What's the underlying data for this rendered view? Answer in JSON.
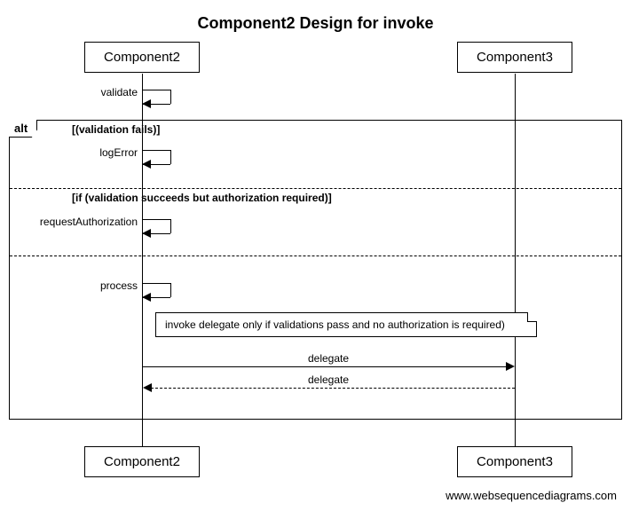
{
  "title": "Component2 Design for invoke",
  "participants": {
    "p1": "Component2",
    "p2": "Component3"
  },
  "messages": {
    "validate": "validate",
    "logError": "logError",
    "requestAuthorization": "requestAuthorization",
    "process": "process",
    "delegate_call": "delegate",
    "delegate_return": "delegate"
  },
  "alt": {
    "label": "alt",
    "guard1": "[(validation fails)]",
    "guard2": "[if (validation succeeds but authorization required)]"
  },
  "note": "invoke delegate only if validations pass and no authorization is required)",
  "footer": "www.websequencediagrams.com",
  "chart_data": {
    "type": "sequence-diagram",
    "title": "Component2 Design for invoke",
    "participants": [
      "Component2",
      "Component3"
    ],
    "interactions": [
      {
        "from": "Component2",
        "to": "Component2",
        "label": "validate",
        "kind": "self"
      },
      {
        "fragment": "alt",
        "sections": [
          {
            "guard": "(validation fails)",
            "interactions": [
              {
                "from": "Component2",
                "to": "Component2",
                "label": "logError",
                "kind": "self"
              }
            ]
          },
          {
            "guard": "if (validation succeeds but authorization required)",
            "interactions": [
              {
                "from": "Component2",
                "to": "Component2",
                "label": "requestAuthorization",
                "kind": "self"
              }
            ]
          },
          {
            "guard": "",
            "interactions": [
              {
                "from": "Component2",
                "to": "Component2",
                "label": "process",
                "kind": "self"
              },
              {
                "note_over": [
                  "Component2",
                  "Component3"
                ],
                "text": "invoke delegate only if validations pass and no authorization is required)"
              },
              {
                "from": "Component2",
                "to": "Component3",
                "label": "delegate",
                "kind": "call"
              },
              {
                "from": "Component3",
                "to": "Component2",
                "label": "delegate",
                "kind": "return"
              }
            ]
          }
        ]
      }
    ]
  }
}
